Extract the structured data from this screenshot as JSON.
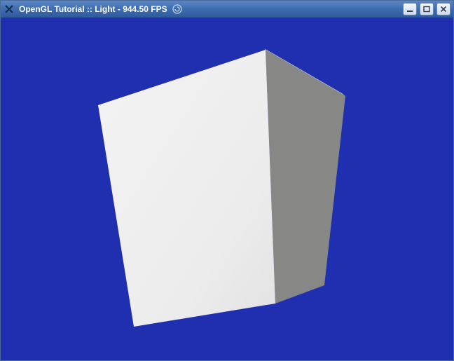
{
  "window": {
    "title": "OpenGL Tutorial :: Light - 944.50 FPS",
    "app_icon": "x-app-icon",
    "distro_icon": "swirl-icon"
  },
  "controls": {
    "minimize": "minimize",
    "maximize": "maximize",
    "close": "close"
  },
  "viewport": {
    "background_color": "#1f2fb0",
    "object": "cube",
    "cube": {
      "front_face_color": "#eeeeee",
      "side_face_color": "#878785",
      "top_edge_color": "#bcbcbc"
    }
  }
}
